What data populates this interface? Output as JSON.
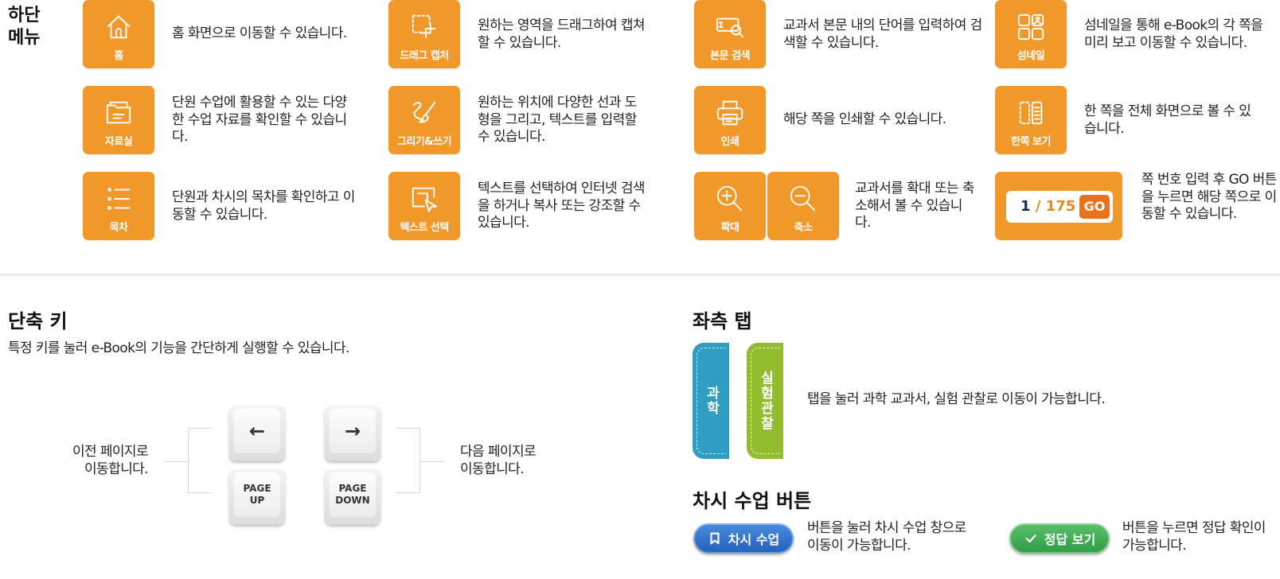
{
  "menu": {
    "title_line1": "하단",
    "title_line2": "메뉴",
    "items": [
      {
        "label": "홈",
        "icon": "home-icon",
        "desc": "홈 화면으로 이동할 수 있습니다."
      },
      {
        "label": "드래그 캡처",
        "icon": "crop-icon",
        "desc": "원하는 영역을 드래그하여 캡쳐 할 수 있습니다."
      },
      {
        "label": "본문 검색",
        "icon": "text-search-icon",
        "desc": "교과서 본문 내의 단어를 입력하여 검색할 수 있습니다."
      },
      {
        "label": "섬네일",
        "icon": "thumbnail-icon",
        "desc": "섬네일을 통해 e-Book의 각 쪽을 미리 보고 이동할 수 있습니다."
      },
      {
        "label": "자료실",
        "icon": "folder-icon",
        "desc": "단원 수업에 활용할 수 있는 다양한 수업 자료를 확인할 수 있습니다."
      },
      {
        "label": "그리기&쓰기",
        "icon": "brush-icon",
        "desc": "원하는 위치에 다양한 선과 도형을 그리고, 텍스트를 입력할 수 있습니다."
      },
      {
        "label": "인쇄",
        "icon": "printer-icon",
        "desc": "해당 쪽을 인쇄할 수 있습니다."
      },
      {
        "label": "한쪽 보기",
        "icon": "single-page-icon",
        "desc": "한 쪽을 전체 화면으로 볼 수 있습니다."
      },
      {
        "label": "목차",
        "icon": "list-icon",
        "desc": "단원과 차시의 목차를 확인하고 이동할 수 있습니다."
      },
      {
        "label": "텍스트 선택",
        "icon": "text-select-icon",
        "desc": "텍스트를 선택하여 인터넷 검색을 하거나 복사 또는 강조할 수 있습니다."
      },
      {
        "label": "확대",
        "icon": "zoom-in-icon",
        "desc": ""
      },
      {
        "label": "축소",
        "icon": "zoom-out-icon",
        "desc": ""
      }
    ],
    "zoom_desc": "교과서를 확대 또는 축소해서 볼 수 있습니다.",
    "page_nav": {
      "current": "1",
      "separator": "/",
      "total": "175",
      "go_label": "GO",
      "desc": "쪽 번호 입력 후 GO 버튼을 누르면 해당 쪽으로 이동할 수 있습니다."
    }
  },
  "shortcuts": {
    "title": "단축 키",
    "subtitle": "특정 키를 눌러 e-Book의 기능을 간단하게 실행할 수 있습니다.",
    "prev_desc_1": "이전 페이지로",
    "prev_desc_2": "이동합니다.",
    "next_desc_1": "다음 페이지로",
    "next_desc_2": "이동합니다.",
    "keys": {
      "left": "←",
      "right": "→",
      "pageup_1": "PAGE",
      "pageup_2": "UP",
      "pagedown_1": "PAGE",
      "pagedown_2": "DOWN"
    }
  },
  "left_tab": {
    "title": "좌측 탭",
    "tab1": "과학",
    "tab2": "실험관찰",
    "desc": "탭을 눌러 과학 교과서, 실험 관찰로 이동이 가능합니다."
  },
  "lesson": {
    "title": "차시 수업 버튼",
    "lesson_button": "차시 수업",
    "lesson_desc_1": "버튼을 눌러 차시 수업 창으로",
    "lesson_desc_2": "이동이 가능합니다.",
    "answer_button": "정답 보기",
    "answer_desc_1": "버튼을 누르면 정답 확인이",
    "answer_desc_2": "가능합니다."
  },
  "colors": {
    "accent": "#f0992a",
    "tab_science": "#2f9ec2",
    "tab_lab": "#93bd2f",
    "lesson_blue": "#2f6fc6",
    "answer_green": "#3aad52"
  }
}
